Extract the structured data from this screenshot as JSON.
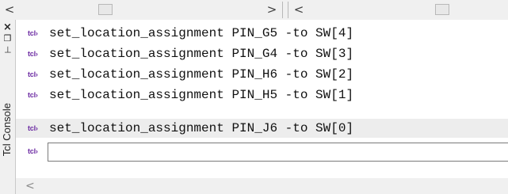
{
  "scrollbars": {
    "left_arrow": "<",
    "right_arrow": ">",
    "second_left_arrow": "<",
    "bottom_left_arrow": "<"
  },
  "side_strip": {
    "close_icon": "×",
    "float_icon": "❐",
    "pin_icon": "⊣",
    "tab_label": "Tcl Console"
  },
  "console": {
    "prompt": "tcl›",
    "lines": [
      "set_location_assignment PIN_G5 -to SW[4]",
      "set_location_assignment PIN_G4 -to SW[3]",
      "set_location_assignment PIN_H6 -to SW[2]",
      "set_location_assignment PIN_H5 -to SW[1]",
      "set_location_assignment PIN_J6 -to SW[0]"
    ],
    "input_value": ""
  }
}
